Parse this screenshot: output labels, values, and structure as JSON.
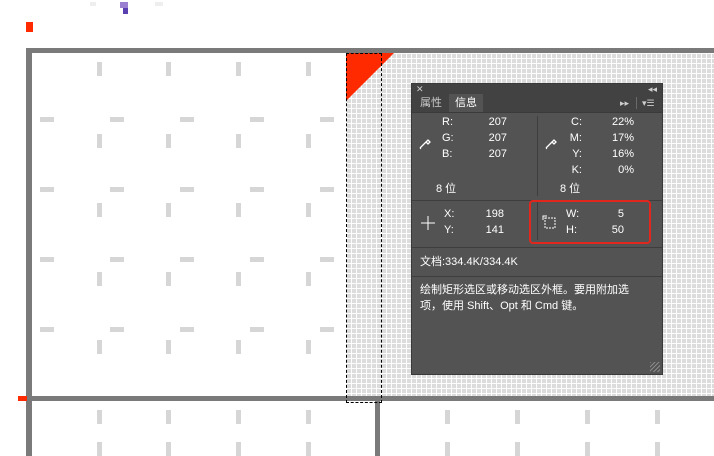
{
  "panel": {
    "tabs": [
      {
        "label": "属性",
        "active": false
      },
      {
        "label": "信息",
        "active": true
      }
    ],
    "rgb": {
      "r_label": "R:",
      "r_value": "207",
      "g_label": "G:",
      "g_value": "207",
      "b_label": "B:",
      "b_value": "207",
      "bit_depth": "8 位"
    },
    "cmyk": {
      "c_label": "C:",
      "c_value": "22%",
      "m_label": "M:",
      "m_value": "17%",
      "y_label": "Y:",
      "y_value": "16%",
      "k_label": "K:",
      "k_value": "0%",
      "bit_depth": "8 位"
    },
    "position": {
      "x_label": "X:",
      "x_value": "198",
      "y_label": "Y:",
      "y_value": "141"
    },
    "size": {
      "w_label": "W:",
      "w_value": "5",
      "h_label": "H:",
      "h_value": "50"
    },
    "doc_info": "文档:334.4K/334.4K",
    "tip_line1": "绘制矩形选区或移动选区外框。要用附加选",
    "tip_line2": "项，使用 Shift、Opt 和 Cmd 键。",
    "icons": {
      "close": "close-icon",
      "collapse": "collapse-icon",
      "menu": "panel-menu-icon",
      "eyedropper": "eyedropper-icon",
      "crosshair": "crosshair-icon",
      "selection_size": "selection-size-icon"
    }
  },
  "colors": {
    "highlight": "#e0261d",
    "red_artwork": "#ff2a00",
    "panel_bg": "#535353"
  }
}
